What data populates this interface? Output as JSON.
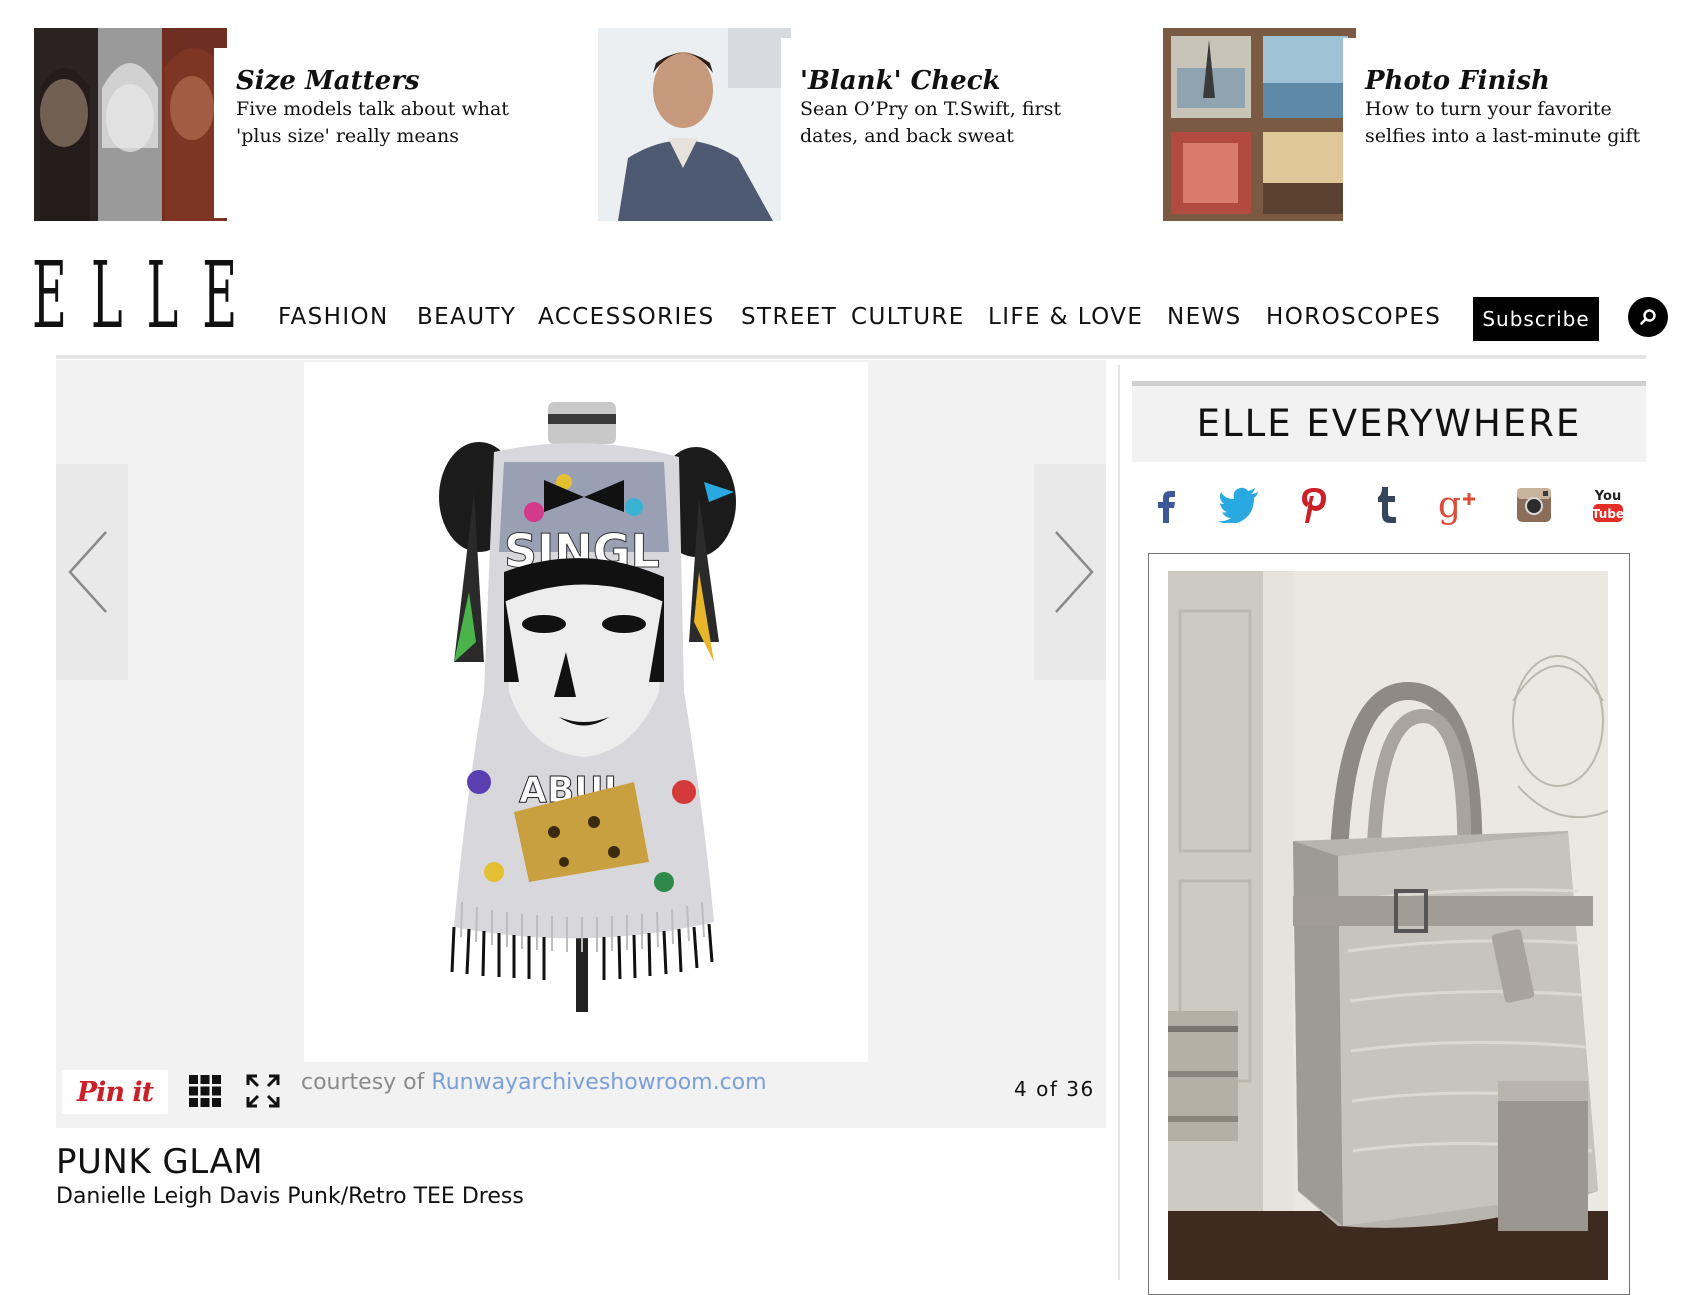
{
  "promos": [
    {
      "title": "Size Matters",
      "desc_line1": "Five models talk about what",
      "desc_line2": "'plus size' really means"
    },
    {
      "title": "'Blank' Check",
      "desc_line1": "Sean O’Pry on T.Swift, first",
      "desc_line2": "dates, and back sweat"
    },
    {
      "title": "Photo Finish",
      "desc_line1": "How to turn your favorite",
      "desc_line2": "selfies into a last-minute gift"
    }
  ],
  "header": {
    "logo": "ELLE",
    "nav": [
      "FASHION",
      "BEAUTY",
      "ACCESSORIES",
      "STREET",
      "CULTURE",
      "LIFE & LOVE",
      "NEWS",
      "HOROSCOPES"
    ],
    "subscribe_label": "Subscribe"
  },
  "gallery": {
    "pin_label": "Pin it",
    "courtesy_prefix": "courtesy of ",
    "courtesy_link": "Runwayarchiveshowroom.com",
    "counter": "4 of 36",
    "slide_title": "PUNK GLAM",
    "slide_caption": "Danielle Leigh Davis Punk/Retro TEE Dress"
  },
  "sidebar": {
    "title": "ELLE EVERYWHERE",
    "social": [
      "facebook-icon",
      "twitter-icon",
      "pinterest-icon",
      "tumblr-icon",
      "google-plus-icon",
      "instagram-icon",
      "youtube-icon"
    ],
    "youtube_text_top": "You",
    "youtube_text_bottom": "Tube"
  },
  "colors": {
    "pinterest_red": "#cb2027",
    "twitter_blue": "#2aa9e0",
    "facebook_blue": "#3b5998",
    "tumblr_navy": "#35465c",
    "gplus_red": "#dd4b39",
    "youtube_red": "#e52d27",
    "link_blue": "#7a9fd8"
  }
}
